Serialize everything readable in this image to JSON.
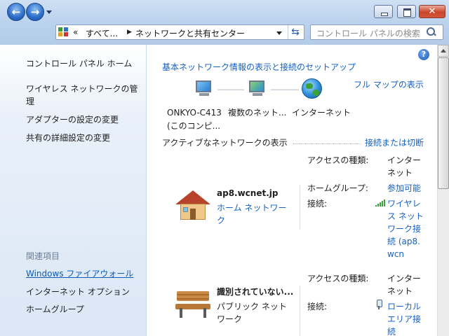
{
  "address_bar": {
    "chevron": "«",
    "crumbs": [
      "すべて...",
      "ネットワークと共有センター"
    ]
  },
  "search": {
    "placeholder": "コントロール パネルの検索"
  },
  "sidebar": {
    "home": "コントロール パネル ホーム",
    "tasks": [
      "ワイヤレス ネットワークの管理",
      "アダプターの設定の変更",
      "共有の詳細設定の変更"
    ],
    "related_heading": "関連項目",
    "related": [
      "Windows ファイアウォール",
      "インターネット オプション",
      "ホームグループ"
    ]
  },
  "main": {
    "title": "基本ネットワーク情報の表示と接続のセットアップ",
    "full_map": "フル マップの表示",
    "map": {
      "computer_line1": "ONKYO-C413",
      "computer_line2": "(このコンピ...",
      "networks": "複数のネット...",
      "internet": "インターネット"
    },
    "active_heading": "アクティブなネットワークの表示",
    "connect_link": "接続または切断",
    "networks": [
      {
        "name": "ap8.wcnet.jp",
        "type": "ホーム ネットワーク",
        "access_label": "アクセスの種類:",
        "access_value": "インターネット",
        "homegroup_label": "ホームグループ:",
        "homegroup_value": "参加可能",
        "connection_label": "接続:",
        "connection_value": "ワイヤレス ネットワーク接続 (ap8.wcn"
      },
      {
        "name": "識別されていない...",
        "type": "パブリック ネットワーク",
        "access_label": "アクセスの種類:",
        "access_value": "インターネット",
        "connection_label": "接続:",
        "connection_value": "ローカル エリア接続"
      }
    ]
  },
  "icons": {
    "back": "back-arrow-icon",
    "forward": "forward-arrow-icon",
    "refresh": "refresh-icon",
    "search": "search-icon",
    "help": "help-icon"
  }
}
